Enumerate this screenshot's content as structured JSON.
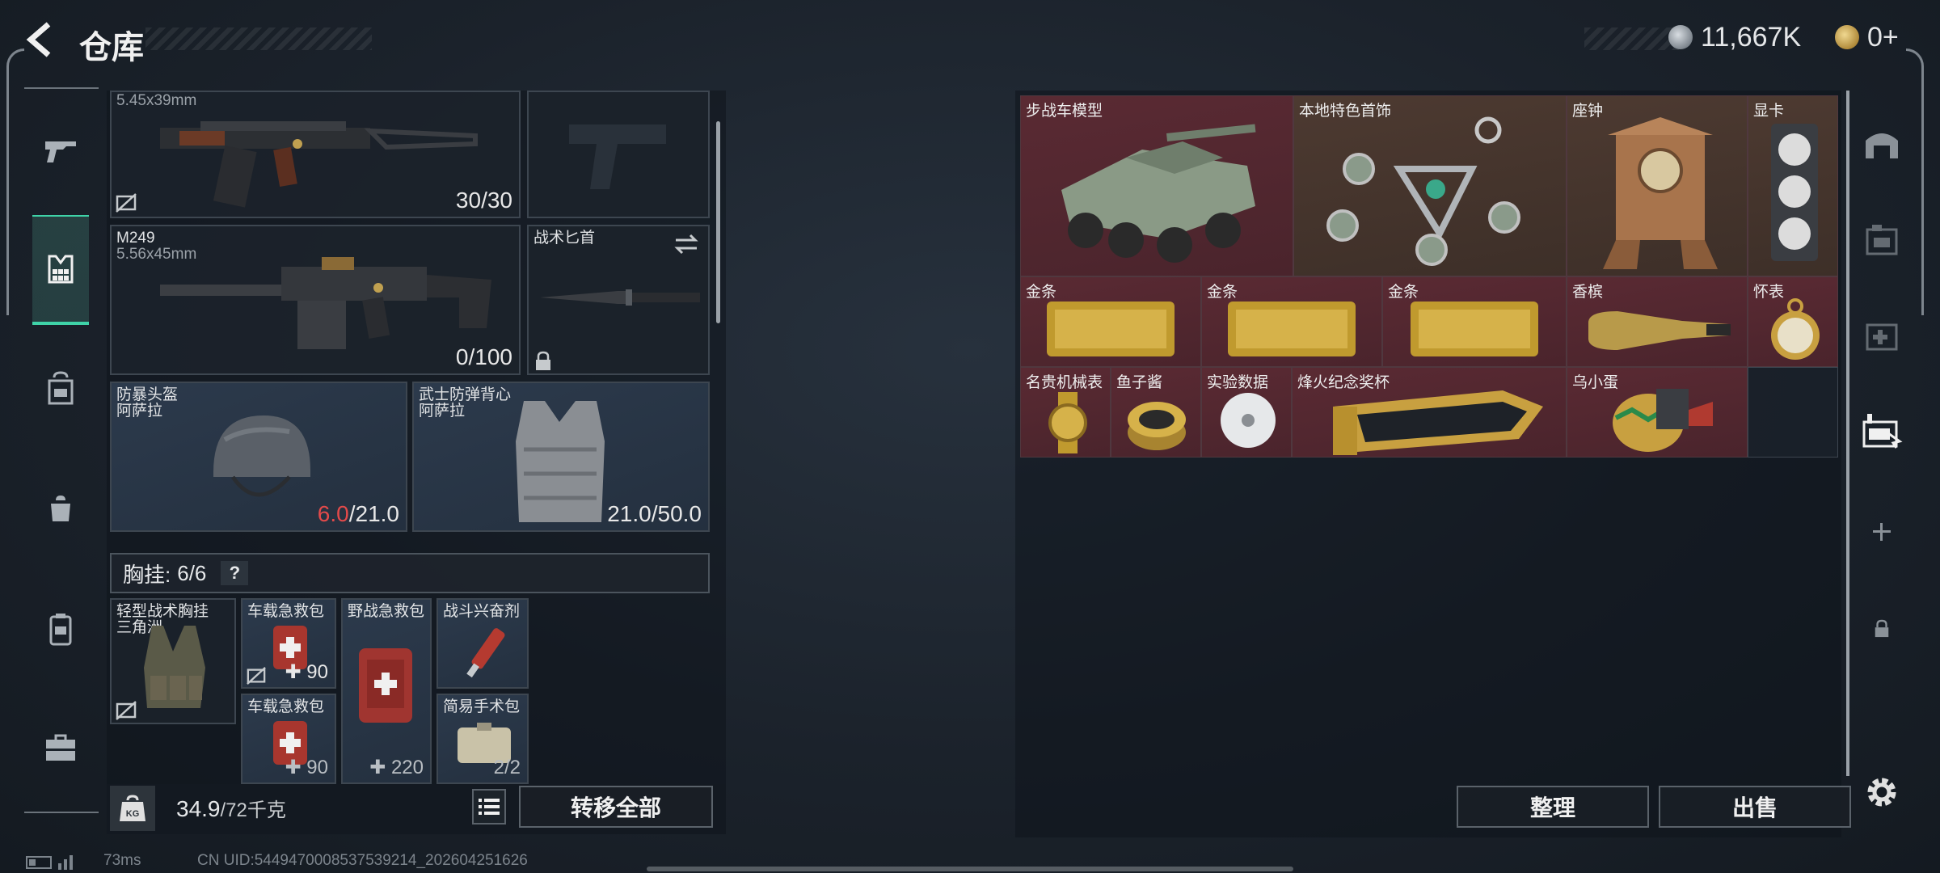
{
  "header": {
    "title": "仓库",
    "currency_amount": "11,667K",
    "token_amount": "0+"
  },
  "colors": {
    "accent": "#3fd3a8",
    "rare_red": "#5a2a33",
    "warning_red": "#e34a4a"
  },
  "sidebar": {
    "tabs": [
      {
        "icon": "gun-icon"
      },
      {
        "icon": "vest-icon",
        "active": true
      },
      {
        "icon": "backpack-icon"
      },
      {
        "icon": "bag-icon"
      },
      {
        "icon": "container-icon"
      },
      {
        "icon": "toolbox-icon"
      }
    ]
  },
  "loadout": {
    "primary": {
      "caliber": "5.45x39mm",
      "ammo": "30/30"
    },
    "secondary": {
      "name": "M249",
      "caliber": "5.56x45mm",
      "ammo": "0/100"
    },
    "melee": {
      "name": "战术匕首"
    },
    "helmet": {
      "name": "防暴头盔",
      "brand": "阿萨拉",
      "durability_current": "6.0",
      "durability_max": "/21.0"
    },
    "armor": {
      "name": "武士防弹背心",
      "brand": "阿萨拉",
      "durability": "21.0/50.0"
    },
    "vest_header": {
      "label": "胸挂:",
      "count": "6/6",
      "help": "?"
    },
    "vest_items": [
      {
        "name": "轻型战术胸挂",
        "sub": "三角洲"
      },
      {
        "name": "车载急救包",
        "value": "90"
      },
      {
        "name": "野战急救包",
        "value": "220"
      },
      {
        "name": "战斗兴奋剂"
      },
      {
        "name": "车载急救包",
        "value": "90"
      },
      {
        "name": "简易手术包",
        "value": "2/2"
      }
    ],
    "weight": {
      "current": "34.9",
      "max": "/72千克",
      "unit_icon": "KG"
    },
    "transfer_all": "转移全部"
  },
  "stash": {
    "items": [
      {
        "name": "步战车模型"
      },
      {
        "name": "本地特色首饰"
      },
      {
        "name": "座钟"
      },
      {
        "name": "显卡"
      },
      {
        "name": "金条"
      },
      {
        "name": "金条"
      },
      {
        "name": "金条"
      },
      {
        "name": "香槟"
      },
      {
        "name": "怀表"
      },
      {
        "name": "名贵机械表"
      },
      {
        "name": "鱼子酱"
      },
      {
        "name": "实验数据"
      },
      {
        "name": "烽火纪念奖杯"
      },
      {
        "name": "乌小蛋"
      }
    ],
    "sort_button": "整理",
    "sell_button": "出售"
  },
  "status_bar": {
    "ping": "73ms",
    "uid": "CN UID:5449470008537539214_202604251626"
  }
}
